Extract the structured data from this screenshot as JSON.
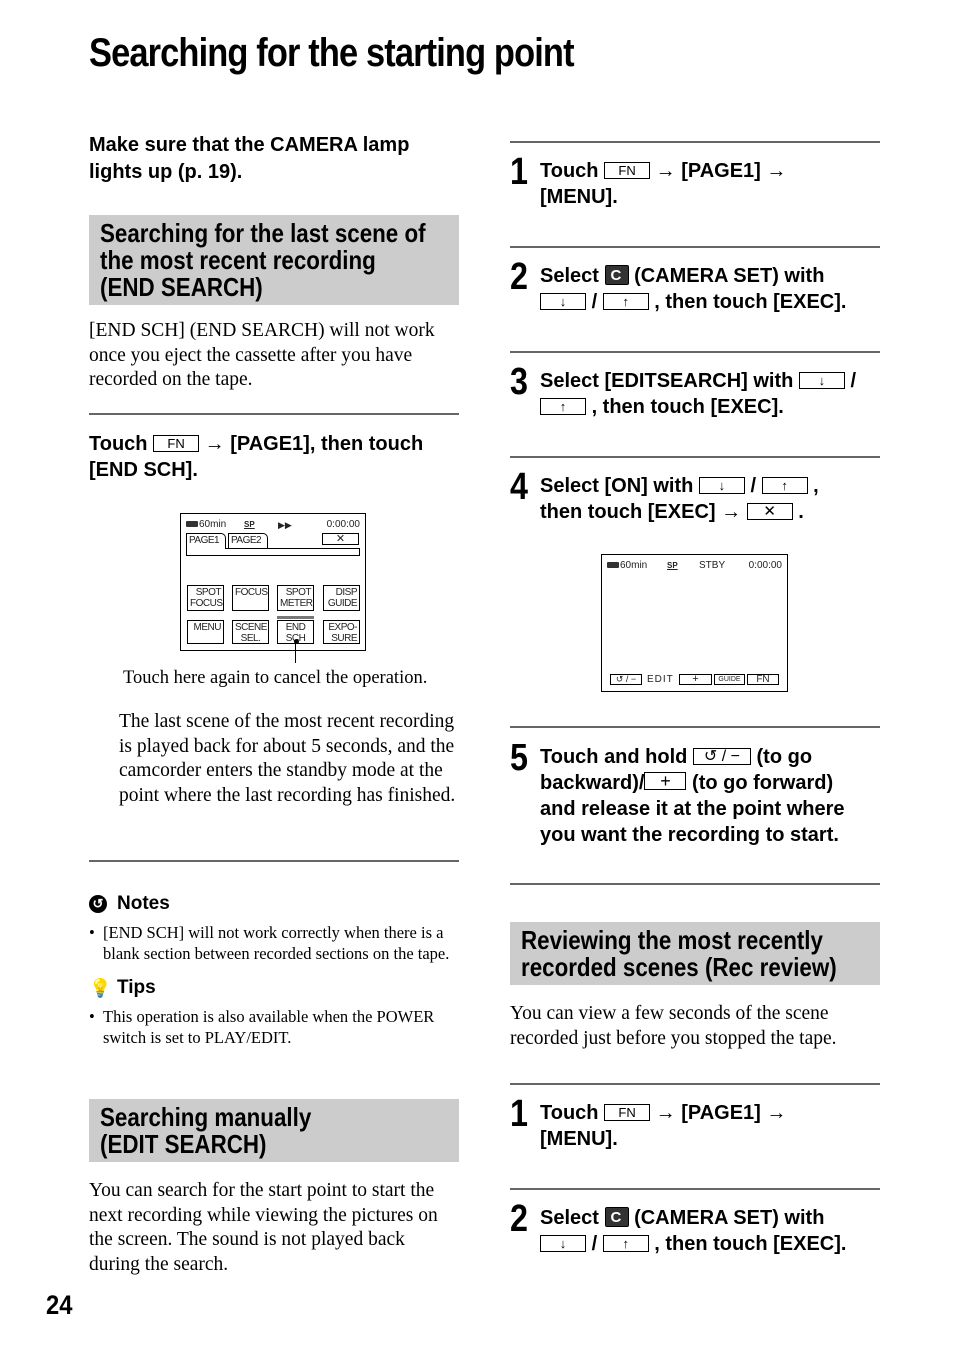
{
  "page": {
    "title": "Searching for the starting point",
    "page_number": "24"
  },
  "left": {
    "intro": "Make sure that the CAMERA lamp lights up (p. 19).",
    "end_search": {
      "heading_lines": [
        "Searching for the last scene of",
        "the most recent recording",
        "(END SEARCH)"
      ],
      "body": "[END SCH] (END SEARCH) will not work once you eject the cassette after you have recorded on the tape.",
      "instruction": {
        "prefix": "Touch",
        "key": "FN",
        "arrow": "→",
        "suffix": "[PAGE1], then touch [END SCH]."
      },
      "lcd": {
        "battery": "60min",
        "mode_icon": "SP",
        "transport": "▶▶",
        "counter": "0:00:00",
        "tabs": [
          "PAGE1",
          "PAGE2"
        ],
        "close": "✕",
        "buttons_row1": [
          {
            "line1": "SPOT",
            "line2": "FOCUS"
          },
          {
            "line1": "FOCUS",
            "line2": ""
          },
          {
            "line1": "SPOT",
            "line2": "METER"
          },
          {
            "line1": "DISP",
            "line2": "GUIDE"
          }
        ],
        "buttons_row2": [
          {
            "line1": "MENU",
            "line2": ""
          },
          {
            "line1": "SCENE",
            "line2": "SEL."
          },
          {
            "line1": "END",
            "line2": "SCH"
          },
          {
            "line1": "EXPO-",
            "line2": "SURE"
          }
        ]
      },
      "callout": "Touch here again to cancel the operation.",
      "result": "The last scene of the most recent recording is played back for about 5 seconds, and the camcorder enters the standby mode at the point where the last recording has finished."
    },
    "notes": {
      "heading": "Notes",
      "icon": "notes-icon",
      "items": [
        "[END SCH] will not work correctly when there is a blank section between recorded sections on the tape."
      ]
    },
    "tips": {
      "heading": "Tips",
      "icon": "lightbulb-icon",
      "items": [
        "This operation is also available when the POWER switch is set to PLAY/EDIT."
      ]
    },
    "edit_search": {
      "heading_lines": [
        "Searching manually",
        "(EDIT SEARCH)"
      ],
      "body": "You can search for the start point to start the next recording while viewing the pictures on the screen. The sound is not played back during the search."
    }
  },
  "right": {
    "edit_steps": [
      {
        "num": "1",
        "parts": [
          "Touch",
          "FN",
          "→ [PAGE1] →",
          "[MENU]."
        ]
      },
      {
        "num": "2",
        "parts": [
          "Select",
          "(CAMERA SET) with",
          "↓",
          "/",
          "↑",
          ", then touch [EXEC]."
        ]
      },
      {
        "num": "3",
        "parts": [
          "Select [EDITSEARCH] with",
          "↓",
          "/",
          "↑",
          ", then touch [EXEC]."
        ]
      },
      {
        "num": "4",
        "parts": [
          "Select [ON] with",
          "↓",
          "/",
          "↑",
          ",",
          "then touch [EXEC] →",
          "✕",
          "."
        ]
      },
      {
        "num": "5",
        "parts": [
          "Touch and hold",
          "↺ / −",
          "(to go",
          "backward)/",
          "+",
          "(to go forward)",
          "and release it at the point where",
          "you want the recording to start."
        ]
      }
    ],
    "lcd2": {
      "battery": "60min",
      "mode_icon": "SP",
      "status": "STBY",
      "counter": "0:00:00",
      "bottom": [
        "↺ / −",
        "EDIT",
        "+",
        "GUIDE",
        "FN"
      ]
    },
    "rec_review": {
      "heading_lines": [
        "Reviewing the most recently",
        "recorded scenes (Rec review)"
      ],
      "body": "You can view a few seconds of the scene recorded just before you stopped the tape.",
      "steps": [
        {
          "num": "1",
          "parts": [
            "Touch",
            "FN",
            "→ [PAGE1] →",
            "[MENU]."
          ]
        },
        {
          "num": "2",
          "parts": [
            "Select",
            "(CAMERA SET) with",
            "↓",
            "/",
            "↑",
            ", then touch [EXEC]."
          ]
        }
      ]
    }
  }
}
